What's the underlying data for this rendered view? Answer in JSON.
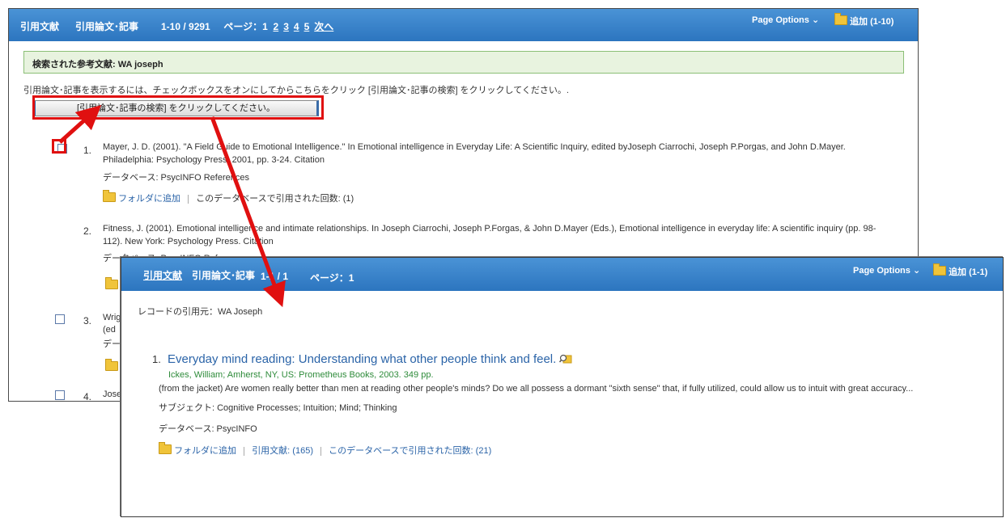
{
  "back": {
    "header": {
      "tab1": "引用文献",
      "tab2": "引用論文･記事",
      "range": "1-10 / 9291",
      "page_label": "ページ：1",
      "pages": [
        "2",
        "3",
        "4",
        "5"
      ],
      "next": "次へ",
      "page_options": "Page Options ⌄",
      "add": "追加 (1-10)"
    },
    "query": "検索された参考文献:  WA joseph",
    "instruction": "引用論文･記事を表示するには、チェックボックスをオンにしてからこちらをクリック [引用論文･記事の検索] をクリックしてください。.",
    "search_button": "[引用論文･記事の検索] をクリックしてください。",
    "results": [
      {
        "num": "1.",
        "line1": "Mayer, J. D. (2001). \"A Field Guide to Emotional Intelligence.\" In Emotional intelligence in Everyday Life: A Scientific Inquiry, edited byJoseph Ciarrochi, Joseph P.Porgas, and John D.Mayer.",
        "line2": "Philadelphia: Psychology Press, 2001, pp. 3-24. Citation",
        "db": "データベース: PsycINFO References",
        "add_folder": "フォルダに追加",
        "cited": "このデータベースで引用された回数: (1)"
      },
      {
        "num": "2.",
        "line1": "Fitness, J. (2001). Emotional intelligence and intimate relationships. In Joseph Ciarrochi, Joseph P.Forgas, & John D.Mayer (Eds.), Emotional intelligence in everyday life: A scientific inquiry (pp. 98-",
        "line2": "112). New York: Psychology Press. Citation",
        "db": "データベース: PsycINFO References"
      },
      {
        "num": "3.",
        "line1": "Wrig",
        "line2": "(ed",
        "db": "デー"
      },
      {
        "num": "4.",
        "line1": "Jose"
      }
    ]
  },
  "front": {
    "header": {
      "tab1": "引用文献",
      "tab2": "引用論文･記事",
      "range": "1-1 / 1",
      "page_label": "ページ：1",
      "page_options": "Page Options ⌄",
      "add": "追加 (1-1)"
    },
    "cited_by": "レコードの引用元：WA Joseph",
    "result": {
      "num": "1.",
      "title": "Everyday mind reading: Understanding what other people think and feel.",
      "author": "Ickes, William; Amherst, NY, US: Prometheus Books, 2003. 349 pp.",
      "abstract": "(from the jacket) Are women really better than men at reading other people's minds? Do we all possess a dormant \"sixth sense\" that, if fully utilized, could allow us to intuit with great accuracy...",
      "subject": "サブジェクト: Cognitive Processes; Intuition; Mind; Thinking",
      "db": "データベース: PsycINFO",
      "add_folder": "フォルダに追加",
      "cited_refs": "引用文献: (165)",
      "cited_count": "このデータベースで引用された回数: (21)"
    }
  },
  "colors": {
    "header": "#2c75bf",
    "annotation": "#e01010",
    "link": "#2b64a8"
  },
  "icons": [
    "folder-icon",
    "magnifier-icon",
    "chevron-down-icon",
    "red-arrow"
  ]
}
